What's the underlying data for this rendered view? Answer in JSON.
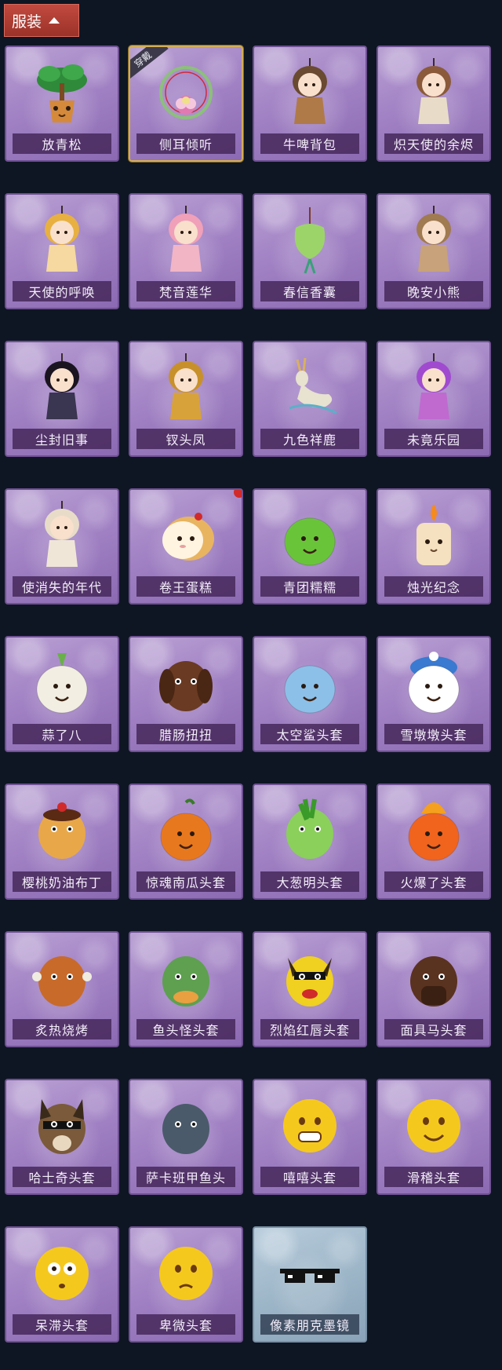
{
  "header": {
    "tab_label": "服装"
  },
  "items": [
    {
      "name": "放青松",
      "icon": "bonsai-pine-icon",
      "color": "#2f8a3a"
    },
    {
      "name": "侧耳倾听",
      "icon": "flower-wreath-icon",
      "color": "#e07ab0",
      "worn": true,
      "badge": "穿戴"
    },
    {
      "name": "牛啤背包",
      "icon": "cow-beer-backpack-icon",
      "color": "#b07a48"
    },
    {
      "name": "炽天使的余烬",
      "icon": "angel-doll-icon",
      "color": "#e8dcc8"
    },
    {
      "name": "天使的呼唤",
      "icon": "cherub-icon",
      "color": "#f5d9a0"
    },
    {
      "name": "梵音莲华",
      "icon": "lotus-doll-icon",
      "color": "#f2b5c6"
    },
    {
      "name": "春信香囊",
      "icon": "sachet-icon",
      "color": "#9cd46a"
    },
    {
      "name": "晚安小熊",
      "icon": "teddy-bear-icon",
      "color": "#c8a27a"
    },
    {
      "name": "尘封旧事",
      "icon": "vampire-doll-icon",
      "color": "#3a3550"
    },
    {
      "name": "钗头凤",
      "icon": "phoenix-crown-icon",
      "color": "#d8a23a"
    },
    {
      "name": "九色祥鹿",
      "icon": "deer-icon",
      "color": "#e8e2d0"
    },
    {
      "name": "未竟乐园",
      "icon": "clown-doll-icon",
      "color": "#c06ad0"
    },
    {
      "name": "使消失的年代",
      "icon": "bride-doll-icon",
      "color": "#f0e6d8"
    },
    {
      "name": "卷王蛋糕",
      "icon": "roll-cake-icon",
      "color": "#e8b460",
      "new": true
    },
    {
      "name": "青团糯糯",
      "icon": "green-mochi-icon",
      "color": "#6ac43a"
    },
    {
      "name": "烛光纪念",
      "icon": "candle-icon",
      "color": "#f5e0c0"
    },
    {
      "name": "蒜了八",
      "icon": "garlic-icon",
      "color": "#f2eee2"
    },
    {
      "name": "腊肠扭扭",
      "icon": "dachshund-icon",
      "color": "#6a3a22"
    },
    {
      "name": "太空鲨头套",
      "icon": "shark-head-icon",
      "color": "#8cc0e8"
    },
    {
      "name": "雪墩墩头套",
      "icon": "snowman-head-icon",
      "color": "#ffffff"
    },
    {
      "name": "樱桃奶油布丁",
      "icon": "pudding-icon",
      "color": "#e8a84a"
    },
    {
      "name": "惊魂南瓜头套",
      "icon": "pumpkin-icon",
      "color": "#e8781e"
    },
    {
      "name": "大葱明头套",
      "icon": "scallion-head-icon",
      "color": "#8ad05a"
    },
    {
      "name": "火爆了头套",
      "icon": "fire-head-icon",
      "color": "#f0641e"
    },
    {
      "name": "炙热烧烤",
      "icon": "meat-bone-icon",
      "color": "#c86a2a"
    },
    {
      "name": "鱼头怪头套",
      "icon": "fish-head-icon",
      "color": "#5ea050"
    },
    {
      "name": "烈焰红唇头套",
      "icon": "pikachu-lips-icon",
      "color": "#f0d020"
    },
    {
      "name": "面具马头套",
      "icon": "horse-head-icon",
      "color": "#5a3220"
    },
    {
      "name": "哈士奇头套",
      "icon": "husky-head-icon",
      "color": "#7a5a3a"
    },
    {
      "name": "萨卡班甲鱼头",
      "icon": "armored-fish-icon",
      "color": "#4a5a6a"
    },
    {
      "name": "嘻嘻头套",
      "icon": "grin-emoji-icon",
      "color": "#f5c81e"
    },
    {
      "name": "滑稽头套",
      "icon": "smirk-emoji-icon",
      "color": "#f5c81e"
    },
    {
      "name": "呆滞头套",
      "icon": "dazed-emoji-icon",
      "color": "#f5c81e"
    },
    {
      "name": "卑微头套",
      "icon": "pleading-emoji-icon",
      "color": "#f5c81e"
    },
    {
      "name": "像素朋克墨镜",
      "icon": "pixel-sunglasses-icon",
      "color": "#111111",
      "grey": true
    }
  ]
}
